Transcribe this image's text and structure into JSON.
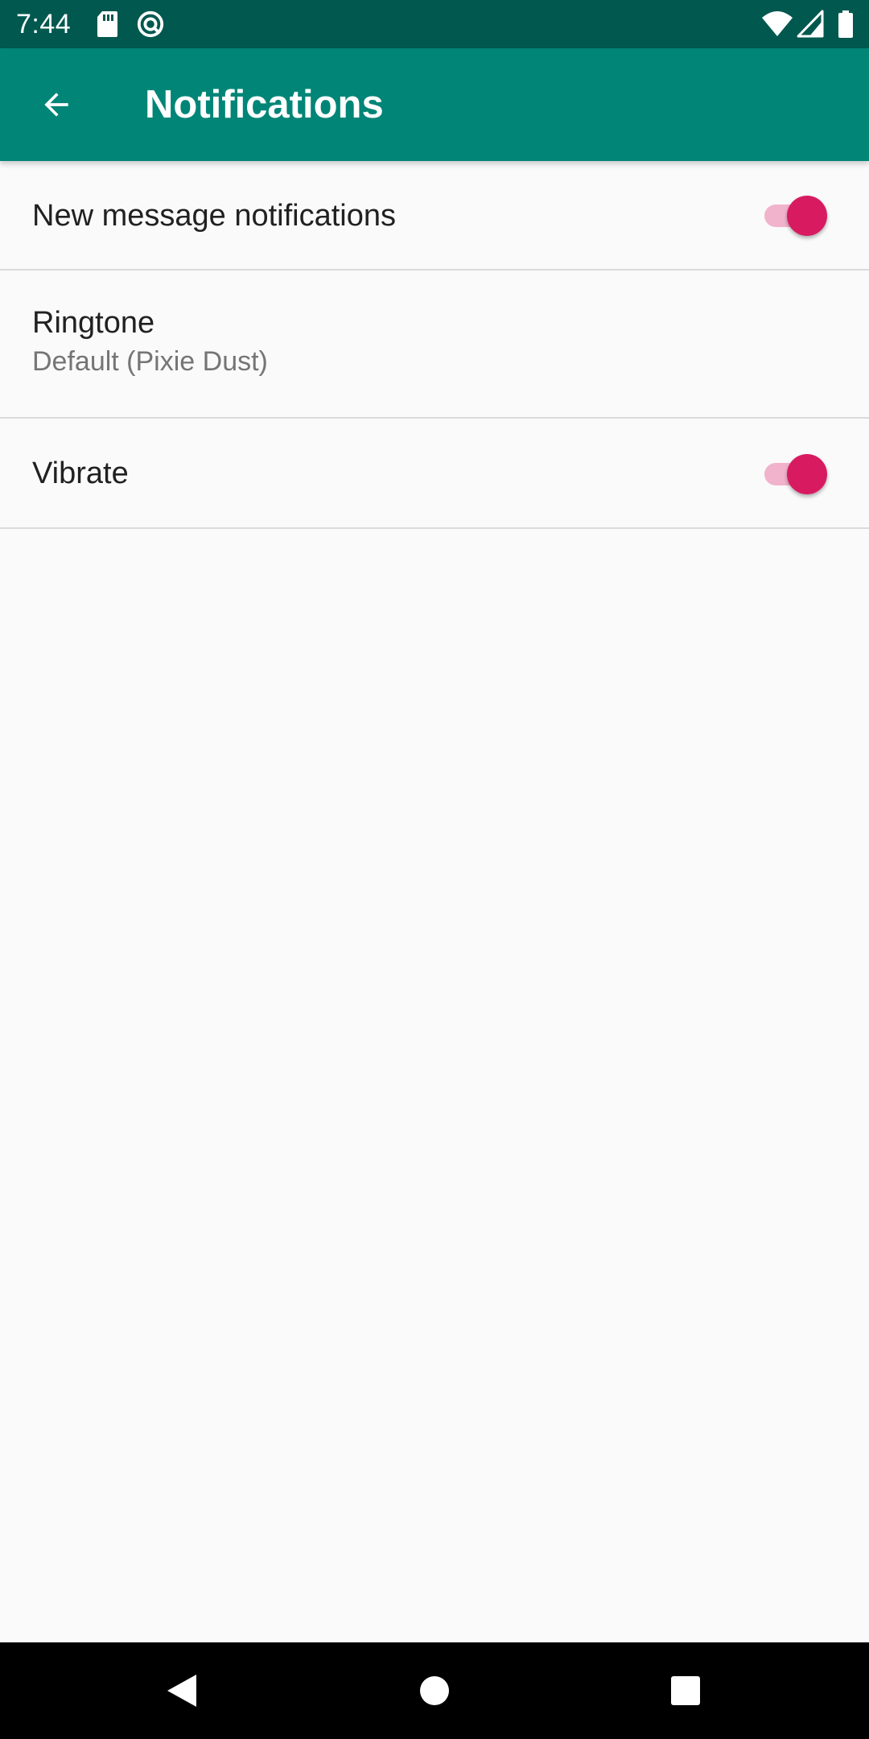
{
  "status_bar": {
    "time": "7:44",
    "icons": [
      "sd-card-icon",
      "sync-icon",
      "wifi-icon",
      "signal-icon",
      "battery-icon"
    ],
    "background": "#00584f"
  },
  "app_bar": {
    "title": "Notifications",
    "back_icon": "arrow-back-icon",
    "background": "#008577"
  },
  "preferences": [
    {
      "title": "New message notifications",
      "type": "switch",
      "checked": true
    },
    {
      "title": "Ringtone",
      "summary": "Default (Pixie Dust)",
      "type": "list"
    },
    {
      "title": "Vibrate",
      "type": "switch",
      "checked": true
    }
  ],
  "colors": {
    "accent": "#d81b60",
    "accent_track": "#f1b3cc",
    "primary": "#008577",
    "primary_dark": "#00584f"
  },
  "nav_bar": {
    "icons": [
      "nav-back-icon",
      "nav-home-icon",
      "nav-recents-icon"
    ]
  }
}
